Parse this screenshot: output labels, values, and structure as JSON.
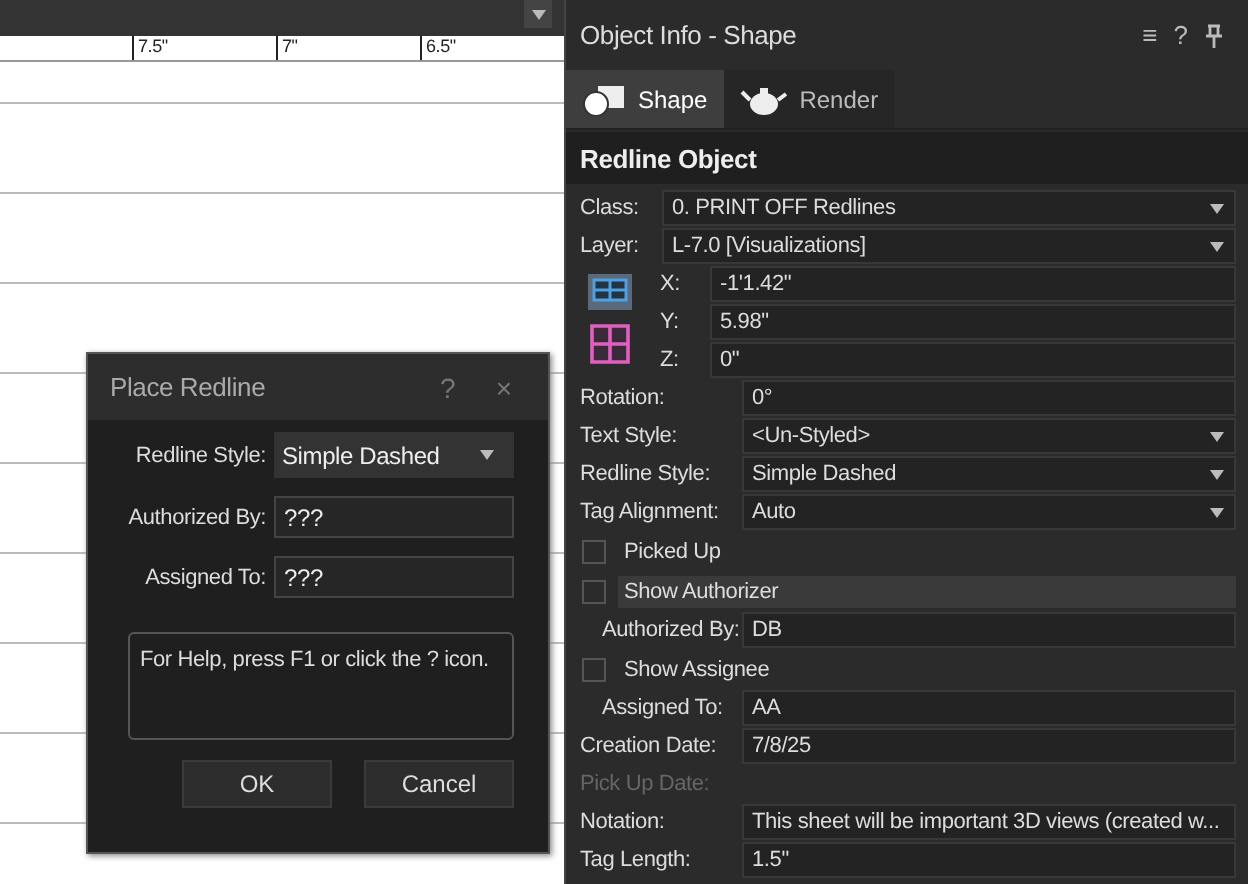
{
  "ruler": {
    "labels": [
      "7.5\"",
      "7\"",
      "6.5\""
    ]
  },
  "dialog": {
    "title": "Place Redline",
    "help_button": "?",
    "close_button": "×",
    "fields": [
      {
        "kind": "select",
        "label": "Redline Style:",
        "value": "Simple Dashed"
      },
      {
        "kind": "field",
        "label": "Authorized By:",
        "value": "???"
      },
      {
        "kind": "field",
        "label": "Assigned To:",
        "value": "???"
      }
    ],
    "help_text": "For Help, press F1 or click the ? icon.",
    "buttons": [
      "OK",
      "Cancel"
    ]
  },
  "panel": {
    "title": "Object Info - Shape",
    "header_icons": [
      "≡",
      "?"
    ],
    "tabs": [
      {
        "label": "Shape",
        "selected": true
      },
      {
        "label": "Render",
        "selected": false
      }
    ],
    "section": "Redline Object",
    "class_row": {
      "label": "Class:",
      "value": "0. PRINT OFF Redlines"
    },
    "layer_row": {
      "label": "Layer:",
      "value": "L-7.0 [Visualizations]"
    },
    "coords": [
      {
        "label": "X:",
        "value": "-1'1.42\""
      },
      {
        "label": "Y:",
        "value": "5.98\""
      },
      {
        "label": "Z:",
        "value": "0\""
      }
    ],
    "rows": [
      {
        "kind": "field",
        "label": "Rotation:",
        "value": "0°",
        "disabled": false
      },
      {
        "kind": "select",
        "label": "Text Style:",
        "value": "<Un-Styled>",
        "disabled": false
      },
      {
        "kind": "select",
        "label": "Redline Style:",
        "value": "Simple Dashed",
        "disabled": false
      },
      {
        "kind": "select",
        "label": "Tag Alignment:",
        "value": "Auto",
        "disabled": false
      },
      {
        "kind": "checkbox",
        "label": "Picked Up",
        "checked": false,
        "highlighted": false
      },
      {
        "kind": "checkbox",
        "label": "Show Authorizer",
        "checked": false,
        "highlighted": true
      },
      {
        "kind": "subfield",
        "label": "Authorized By:",
        "value": "DB",
        "disabled": false
      },
      {
        "kind": "checkbox",
        "label": "Show Assignee",
        "checked": false,
        "highlighted": false
      },
      {
        "kind": "subfield",
        "label": "Assigned To:",
        "value": "AA",
        "disabled": false
      },
      {
        "kind": "field",
        "label": "Creation Date:",
        "value": "7/8/25",
        "disabled": false
      },
      {
        "kind": "label",
        "label": "Pick Up Date:",
        "disabled": true
      },
      {
        "kind": "field",
        "label": "Notation:",
        "value": "This sheet will be important 3D views (created w...",
        "disabled": false
      },
      {
        "kind": "field",
        "label": "Tag Length:",
        "value": "1.5\"",
        "disabled": false
      }
    ]
  }
}
